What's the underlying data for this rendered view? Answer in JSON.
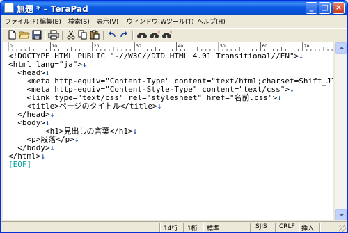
{
  "window": {
    "title": "無題 * – TeraPad",
    "buttons": {
      "minimize": "_",
      "maximize": "□",
      "close": "×"
    }
  },
  "menu": [
    "ファイル(F)",
    "編集(E)",
    "検索(S)",
    "表示(V)",
    "ウィンドウ(W)",
    "ツール(T)",
    "ヘルプ(H)"
  ],
  "toolbar": {
    "icons": [
      "new-file-icon",
      "open-folder-icon",
      "save-icon",
      "print-icon",
      "cut-icon",
      "copy-icon",
      "paste-icon",
      "undo-icon",
      "redo-icon",
      "find-icon",
      "find-next-icon",
      "find-prev-icon"
    ]
  },
  "ruler": {
    "labels": [
      "0",
      "10",
      "20",
      "30",
      "40",
      "50",
      "60",
      "70"
    ]
  },
  "editor": {
    "lines": [
      "<!DOCTYPE HTML PUBLIC \"-//W3C//DTD HTML 4.01 Transitional//EN\">",
      "<html lang=\"ja\">",
      "  <head>",
      "    <meta http-equiv=\"Content-Type\" content=\"text/html;charset=Shift_JIS\">",
      "    <meta http-equiv=\"Content-Style-Type\" content=\"text/css\">",
      "    <link type=\"text/css\" rel=\"stylesheet\" href=\"名前.css\">",
      "    <title>ページのタイトル</title>",
      "  </head>",
      "  <body>",
      "        <h1>見出しの言葉</h1>",
      "    <p>段落</p>",
      "  </body>",
      "</html>"
    ],
    "eol_mark": "↓",
    "eof_mark": "[EOF]"
  },
  "status": {
    "line": "14行",
    "column": "1桁",
    "mode": "標準",
    "encoding": "SJIS",
    "line_ending": "CRLF",
    "insert_mode": "挿入"
  }
}
